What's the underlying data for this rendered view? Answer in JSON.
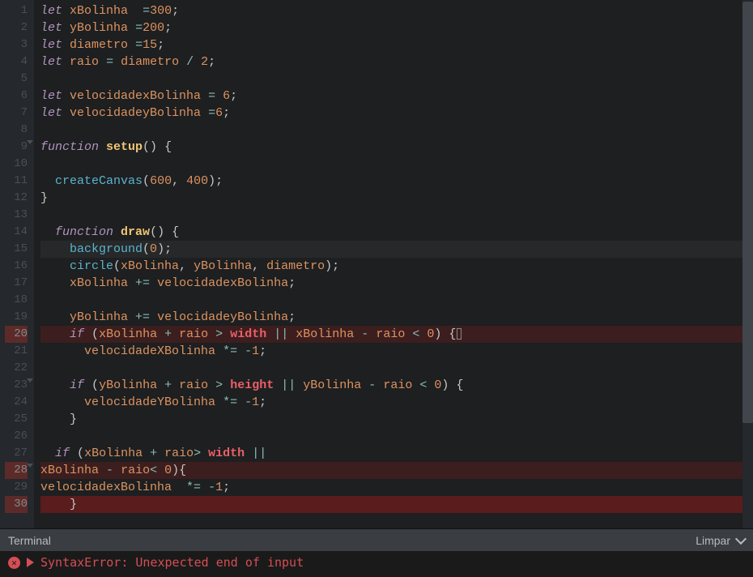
{
  "editor": {
    "activeLine": 15,
    "errorGutterLines": [
      20,
      28,
      30
    ],
    "foldLines": [
      9,
      23,
      28
    ],
    "lines": [
      {
        "n": 1,
        "t": [
          [
            "kw",
            "let"
          ],
          [
            "sp",
            " "
          ],
          [
            "var",
            "xBolinha"
          ],
          [
            "sp",
            "  "
          ],
          [
            "op",
            "="
          ],
          [
            "num",
            "300"
          ],
          [
            "pun",
            ";"
          ]
        ]
      },
      {
        "n": 2,
        "t": [
          [
            "kw",
            "let"
          ],
          [
            "sp",
            " "
          ],
          [
            "var",
            "yBolinha"
          ],
          [
            "sp",
            " "
          ],
          [
            "op",
            "="
          ],
          [
            "num",
            "200"
          ],
          [
            "pun",
            ";"
          ]
        ]
      },
      {
        "n": 3,
        "t": [
          [
            "kw",
            "let"
          ],
          [
            "sp",
            " "
          ],
          [
            "var",
            "diametro"
          ],
          [
            "sp",
            " "
          ],
          [
            "op",
            "="
          ],
          [
            "num",
            "15"
          ],
          [
            "pun",
            ";"
          ]
        ]
      },
      {
        "n": 4,
        "t": [
          [
            "kw",
            "let"
          ],
          [
            "sp",
            " "
          ],
          [
            "var",
            "raio"
          ],
          [
            "sp",
            " "
          ],
          [
            "op",
            "="
          ],
          [
            "sp",
            " "
          ],
          [
            "var",
            "diametro"
          ],
          [
            "sp",
            " "
          ],
          [
            "op",
            "/"
          ],
          [
            "sp",
            " "
          ],
          [
            "num",
            "2"
          ],
          [
            "pun",
            ";"
          ]
        ]
      },
      {
        "n": 5,
        "t": []
      },
      {
        "n": 6,
        "t": [
          [
            "kw",
            "let"
          ],
          [
            "sp",
            " "
          ],
          [
            "var",
            "velocidadexBolinha"
          ],
          [
            "sp",
            " "
          ],
          [
            "op",
            "="
          ],
          [
            "sp",
            " "
          ],
          [
            "num",
            "6"
          ],
          [
            "pun",
            ";"
          ]
        ]
      },
      {
        "n": 7,
        "t": [
          [
            "kw",
            "let"
          ],
          [
            "sp",
            " "
          ],
          [
            "var",
            "velocidadeyBolinha"
          ],
          [
            "sp",
            " "
          ],
          [
            "op",
            "="
          ],
          [
            "num",
            "6"
          ],
          [
            "pun",
            ";"
          ]
        ]
      },
      {
        "n": 8,
        "t": []
      },
      {
        "n": 9,
        "t": [
          [
            "kw",
            "function"
          ],
          [
            "sp",
            " "
          ],
          [
            "bold",
            "setup"
          ],
          [
            "paren",
            "()"
          ],
          [
            "sp",
            " "
          ],
          [
            "pun",
            "{"
          ]
        ]
      },
      {
        "n": 10,
        "t": []
      },
      {
        "n": 11,
        "t": [
          [
            "sp",
            "  "
          ],
          [
            "call",
            "createCanvas"
          ],
          [
            "paren",
            "("
          ],
          [
            "num",
            "600"
          ],
          [
            "pun",
            ","
          ],
          [
            "sp",
            " "
          ],
          [
            "num",
            "400"
          ],
          [
            "paren",
            ")"
          ],
          [
            "pun",
            ";"
          ]
        ]
      },
      {
        "n": 12,
        "t": [
          [
            "pun",
            "}"
          ]
        ]
      },
      {
        "n": 13,
        "t": []
      },
      {
        "n": 14,
        "t": [
          [
            "sp",
            "  "
          ],
          [
            "kw",
            "function"
          ],
          [
            "sp",
            " "
          ],
          [
            "bold",
            "draw"
          ],
          [
            "paren",
            "()"
          ],
          [
            "sp",
            " "
          ],
          [
            "pun",
            "{"
          ]
        ]
      },
      {
        "n": 15,
        "t": [
          [
            "sp",
            "    "
          ],
          [
            "call",
            "background"
          ],
          [
            "paren",
            "("
          ],
          [
            "num",
            "0"
          ],
          [
            "paren",
            ")"
          ],
          [
            "pun",
            ";"
          ]
        ]
      },
      {
        "n": 16,
        "t": [
          [
            "sp",
            "    "
          ],
          [
            "call",
            "circle"
          ],
          [
            "paren",
            "("
          ],
          [
            "var",
            "xBolinha"
          ],
          [
            "pun",
            ","
          ],
          [
            "sp",
            " "
          ],
          [
            "var",
            "yBolinha"
          ],
          [
            "pun",
            ","
          ],
          [
            "sp",
            " "
          ],
          [
            "var",
            "diametro"
          ],
          [
            "paren",
            ")"
          ],
          [
            "pun",
            ";"
          ]
        ]
      },
      {
        "n": 17,
        "t": [
          [
            "sp",
            "    "
          ],
          [
            "var",
            "xBolinha"
          ],
          [
            "sp",
            " "
          ],
          [
            "op",
            "+="
          ],
          [
            "sp",
            " "
          ],
          [
            "var",
            "velocidadexBolinha"
          ],
          [
            "pun",
            ";"
          ]
        ]
      },
      {
        "n": 18,
        "t": []
      },
      {
        "n": 19,
        "t": [
          [
            "sp",
            "    "
          ],
          [
            "var",
            "yBolinha"
          ],
          [
            "sp",
            " "
          ],
          [
            "op",
            "+="
          ],
          [
            "sp",
            " "
          ],
          [
            "var",
            "velocidadeyBolinha"
          ],
          [
            "pun",
            ";"
          ]
        ]
      },
      {
        "n": 20,
        "t": [
          [
            "sp",
            "    "
          ],
          [
            "kw",
            "if"
          ],
          [
            "sp",
            " "
          ],
          [
            "paren",
            "("
          ],
          [
            "var",
            "xBolinha"
          ],
          [
            "sp",
            " "
          ],
          [
            "op",
            "+"
          ],
          [
            "sp",
            " "
          ],
          [
            "var",
            "raio"
          ],
          [
            "sp",
            " "
          ],
          [
            "op",
            ">"
          ],
          [
            "sp",
            " "
          ],
          [
            "const",
            "width"
          ],
          [
            "sp",
            " "
          ],
          [
            "op",
            "||"
          ],
          [
            "sp",
            " "
          ],
          [
            "var",
            "xBolinha"
          ],
          [
            "sp",
            " "
          ],
          [
            "op",
            "-"
          ],
          [
            "sp",
            " "
          ],
          [
            "var",
            "raio"
          ],
          [
            "sp",
            " "
          ],
          [
            "op",
            "<"
          ],
          [
            "sp",
            " "
          ],
          [
            "num",
            "0"
          ],
          [
            "paren",
            ")"
          ],
          [
            "sp",
            " "
          ],
          [
            "pun",
            "{"
          ],
          [
            "endmark",
            ""
          ]
        ]
      },
      {
        "n": 21,
        "t": [
          [
            "sp",
            "      "
          ],
          [
            "var",
            "velocidadeXBolinha"
          ],
          [
            "sp",
            " "
          ],
          [
            "op",
            "*="
          ],
          [
            "sp",
            " "
          ],
          [
            "op",
            "-"
          ],
          [
            "num",
            "1"
          ],
          [
            "pun",
            ";"
          ]
        ]
      },
      {
        "n": 22,
        "t": []
      },
      {
        "n": 23,
        "t": [
          [
            "sp",
            "    "
          ],
          [
            "kw",
            "if"
          ],
          [
            "sp",
            " "
          ],
          [
            "paren",
            "("
          ],
          [
            "var",
            "yBolinha"
          ],
          [
            "sp",
            " "
          ],
          [
            "op",
            "+"
          ],
          [
            "sp",
            " "
          ],
          [
            "var",
            "raio"
          ],
          [
            "sp",
            " "
          ],
          [
            "op",
            ">"
          ],
          [
            "sp",
            " "
          ],
          [
            "const",
            "height"
          ],
          [
            "sp",
            " "
          ],
          [
            "op",
            "||"
          ],
          [
            "sp",
            " "
          ],
          [
            "var",
            "yBolinha"
          ],
          [
            "sp",
            " "
          ],
          [
            "op",
            "-"
          ],
          [
            "sp",
            " "
          ],
          [
            "var",
            "raio"
          ],
          [
            "sp",
            " "
          ],
          [
            "op",
            "<"
          ],
          [
            "sp",
            " "
          ],
          [
            "num",
            "0"
          ],
          [
            "paren",
            ")"
          ],
          [
            "sp",
            " "
          ],
          [
            "pun",
            "{"
          ]
        ]
      },
      {
        "n": 24,
        "t": [
          [
            "sp",
            "      "
          ],
          [
            "var",
            "velocidadeYBolinha"
          ],
          [
            "sp",
            " "
          ],
          [
            "op",
            "*="
          ],
          [
            "sp",
            " "
          ],
          [
            "op",
            "-"
          ],
          [
            "num",
            "1"
          ],
          [
            "pun",
            ";"
          ]
        ]
      },
      {
        "n": 25,
        "t": [
          [
            "sp",
            "    "
          ],
          [
            "pun",
            "}"
          ]
        ]
      },
      {
        "n": 26,
        "t": []
      },
      {
        "n": 27,
        "t": [
          [
            "sp",
            "  "
          ],
          [
            "kw",
            "if"
          ],
          [
            "sp",
            " "
          ],
          [
            "paren",
            "("
          ],
          [
            "var",
            "xBolinha"
          ],
          [
            "sp",
            " "
          ],
          [
            "op",
            "+"
          ],
          [
            "sp",
            " "
          ],
          [
            "var",
            "raio"
          ],
          [
            "op",
            ">"
          ],
          [
            "sp",
            " "
          ],
          [
            "const",
            "width"
          ],
          [
            "sp",
            " "
          ],
          [
            "op",
            "||"
          ]
        ]
      },
      {
        "n": 28,
        "t": [
          [
            "var",
            "xBolinha"
          ],
          [
            "sp",
            " "
          ],
          [
            "op",
            "-"
          ],
          [
            "sp",
            " "
          ],
          [
            "var",
            "raio"
          ],
          [
            "op",
            "<"
          ],
          [
            "sp",
            " "
          ],
          [
            "num",
            "0"
          ],
          [
            "paren",
            ")"
          ],
          [
            "pun",
            "{"
          ]
        ]
      },
      {
        "n": 29,
        "t": [
          [
            "var",
            "velocidadexBolinha"
          ],
          [
            "sp",
            "  "
          ],
          [
            "op",
            "*="
          ],
          [
            "sp",
            " "
          ],
          [
            "op",
            "-"
          ],
          [
            "num",
            "1"
          ],
          [
            "pun",
            ";"
          ]
        ]
      },
      {
        "n": 30,
        "t": [
          [
            "sp",
            "    "
          ],
          [
            "pun",
            "}"
          ]
        ]
      }
    ]
  },
  "terminal": {
    "title": "Terminal",
    "clear": "Limpar",
    "errorCross": "✕",
    "message": "SyntaxError: Unexpected end of input"
  }
}
